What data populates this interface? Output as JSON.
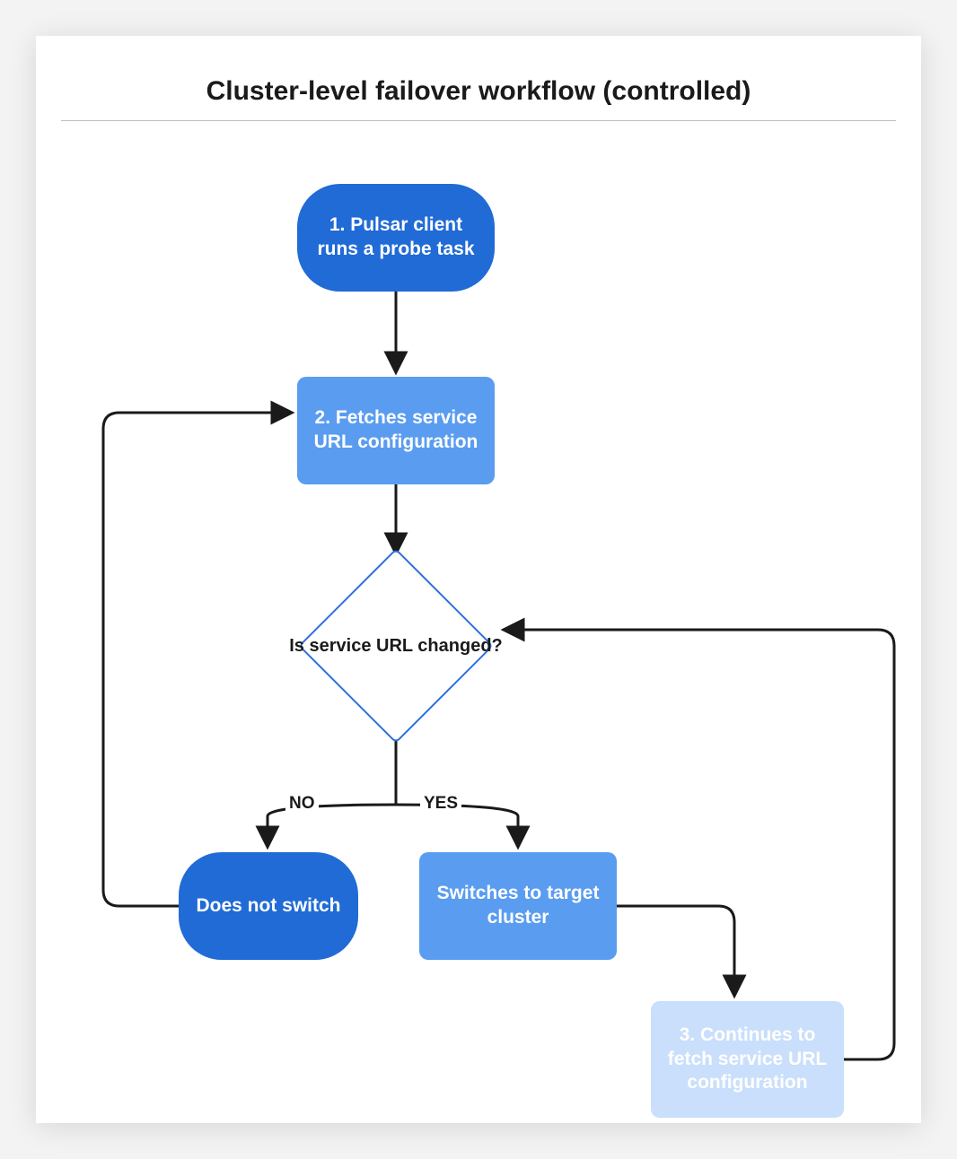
{
  "title": "Cluster-level failover workflow (controlled)",
  "nodes": {
    "n1": "1. Pulsar client runs a probe task",
    "n2": "2. Fetches service URL configuration",
    "decision": "Is service URL changed?",
    "n4": "Does not switch",
    "n5": "Switches to target cluster",
    "n6": "3. Continues to fetch service URL configuration"
  },
  "edges": {
    "no": "NO",
    "yes": "YES"
  },
  "colors": {
    "dark": "#206bd6",
    "mid": "#5a9cf0",
    "light": "#c9dffb",
    "border": "#2a6fdc"
  }
}
